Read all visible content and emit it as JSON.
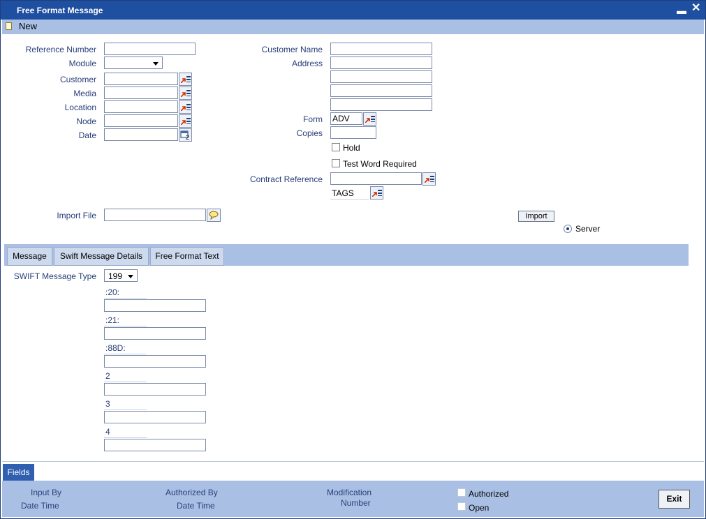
{
  "window": {
    "title": "Free Format Message"
  },
  "toolbar": {
    "new_label": "New"
  },
  "form": {
    "reference_number_label": "Reference Number",
    "module_label": "Module",
    "customer_label": "Customer",
    "media_label": "Media",
    "location_label": "Location",
    "node_label": "Node",
    "date_label": "Date",
    "customer_name_label": "Customer Name",
    "address_label": "Address",
    "form_label": "Form",
    "form_value": "ADV",
    "copies_label": "Copies",
    "hold_label": "Hold",
    "test_word_label": "Test Word Required",
    "contract_reference_label": "Contract Reference",
    "tags_value": "TAGS",
    "import_file_label": "Import File",
    "import_button": "Import",
    "server_label": "Server"
  },
  "tabs": [
    {
      "label": "Message"
    },
    {
      "label": "Swift Message Details"
    },
    {
      "label": "Free Format Text"
    }
  ],
  "message": {
    "swift_type_label": "SWIFT Message Type",
    "swift_type_value": "199",
    "fields": [
      {
        "label": ":20:"
      },
      {
        "label": ":21:"
      },
      {
        "label": ":88D:"
      },
      {
        "label": "2"
      },
      {
        "label": "3"
      },
      {
        "label": "4"
      }
    ]
  },
  "footer": {
    "fields_button": "Fields",
    "input_by": "Input By",
    "date_time_1": "Date Time",
    "authorized_by": "Authorized By",
    "date_time_2": "Date Time",
    "modification": "Modification",
    "number": "Number",
    "authorized": "Authorized",
    "open": "Open",
    "exit_button": "Exit"
  },
  "colors": {
    "titlebar": "#1f4fa0",
    "panel": "#a9c0e4",
    "label": "#2a3f7a"
  }
}
